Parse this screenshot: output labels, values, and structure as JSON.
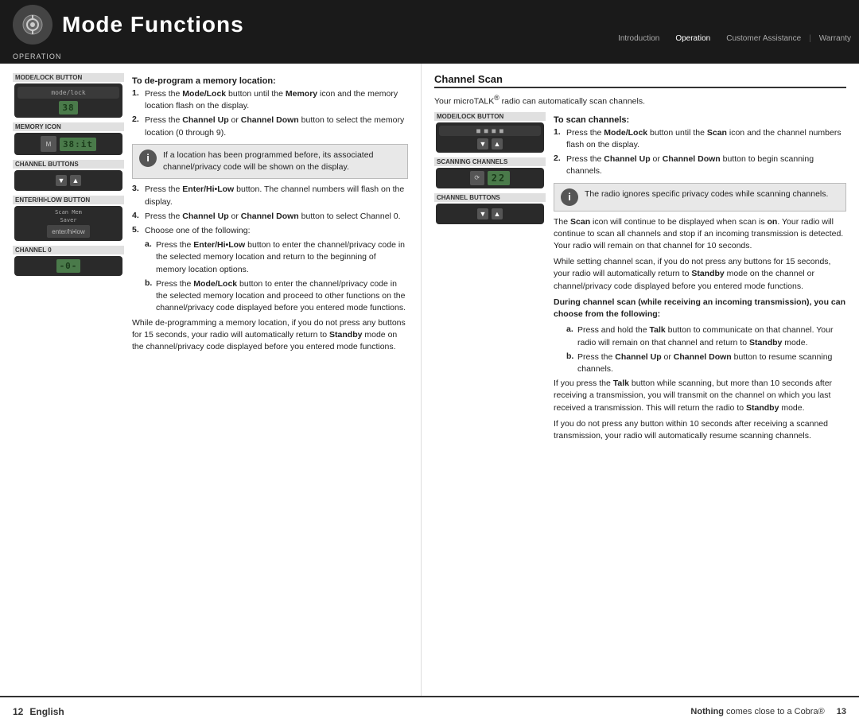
{
  "header": {
    "title": "Mode Functions",
    "icon_alt": "mode-icon",
    "nav_items": [
      "Introduction",
      "Operation",
      "Customer Assistance",
      "Warranty"
    ],
    "operation_label": "Operation"
  },
  "left_section": {
    "subtitle": "To de-program a memory location:",
    "steps": [
      {
        "num": "1.",
        "text_parts": [
          {
            "text": "Press the ",
            "bold": false
          },
          {
            "text": "Mode/Lock",
            "bold": true
          },
          {
            "text": " button until the ",
            "bold": false
          },
          {
            "text": "Memory",
            "bold": true
          },
          {
            "text": " icon and the memory location flash on the display.",
            "bold": false
          }
        ],
        "plain": "Press the Mode/Lock button until the Memory icon and the memory location flash on the display."
      },
      {
        "num": "2.",
        "text_parts": [
          {
            "text": "Press the ",
            "bold": false
          },
          {
            "text": "Channel Up",
            "bold": true
          },
          {
            "text": " or ",
            "bold": false
          },
          {
            "text": "Channel Down",
            "bold": true
          },
          {
            "text": " button to select the memory location (0 through 9).",
            "bold": false
          }
        ],
        "plain": "Press the Channel Up or Channel Down button to select the memory location (0 through 9)."
      },
      {
        "num": "3.",
        "text_parts": [
          {
            "text": "Press the ",
            "bold": false
          },
          {
            "text": "Enter/Hi•Low",
            "bold": true
          },
          {
            "text": " button. The channel numbers will flash on the display.",
            "bold": false
          }
        ],
        "plain": "Press the Enter/Hi•Low button. The channel numbers will flash on the display."
      },
      {
        "num": "4.",
        "text_parts": [
          {
            "text": "Press the ",
            "bold": false
          },
          {
            "text": "Channel Up",
            "bold": true
          },
          {
            "text": " or ",
            "bold": false
          },
          {
            "text": "Channel Down",
            "bold": true
          },
          {
            "text": " button to select Channel 0.",
            "bold": false
          }
        ],
        "plain": "Press the Channel Up or Channel Down button to select Channel 0."
      },
      {
        "num": "5.",
        "plain": "Choose one of the following:"
      }
    ],
    "alpha_a": {
      "label": "a.",
      "text_parts": [
        {
          "text": "Press the ",
          "bold": false
        },
        {
          "text": "Enter/Hi•Low",
          "bold": true
        },
        {
          "text": " button to enter the channel/privacy code in the selected memory location and return to the beginning of memory location options.",
          "bold": false
        }
      ]
    },
    "alpha_b": {
      "label": "b.",
      "text_parts": [
        {
          "text": "Press the ",
          "bold": false
        },
        {
          "text": "Mode/Lock",
          "bold": true
        },
        {
          "text": " button to enter the channel/privacy code in the selected memory location and proceed to other functions on the channel/privacy code displayed before you entered mode functions.",
          "bold": false
        }
      ]
    },
    "info_box": {
      "text": "If a location has been programmed before, its associated channel/privacy code will be shown on the display."
    },
    "closing_text": "While de-programming a memory location, if you do not press any buttons for 15 seconds, your radio will automatically return to Standby mode on the channel/privacy code displayed before you entered mode functions.",
    "image_labels": {
      "mode_lock": "Mode/Lock Button",
      "memory_icon": "Memory Icon",
      "channel_buttons": "Channel Buttons",
      "enter_hi_low": "Enter/Hi•Low Button",
      "channel_0": "Channel 0"
    }
  },
  "right_section": {
    "title": "Channel Scan",
    "intro": "Your microTALK® radio can automatically scan channels.",
    "subtitle": "To scan channels:",
    "steps": [
      {
        "num": "1.",
        "text_parts": [
          {
            "text": "Press the ",
            "bold": false
          },
          {
            "text": "Mode/Lock",
            "bold": true
          },
          {
            "text": " button until the ",
            "bold": false
          },
          {
            "text": "Scan",
            "bold": true
          },
          {
            "text": " icon and the channel numbers flash on the display.",
            "bold": false
          }
        ]
      },
      {
        "num": "2.",
        "text_parts": [
          {
            "text": "Press the ",
            "bold": false
          },
          {
            "text": "Channel Up",
            "bold": true
          },
          {
            "text": " or ",
            "bold": false
          },
          {
            "text": "Channel Down",
            "bold": true
          },
          {
            "text": " button to begin scanning channels.",
            "bold": false
          }
        ]
      }
    ],
    "info_box": {
      "text": "The radio ignores specific privacy codes while scanning channels."
    },
    "scan_description": "The Scan icon will continue to be displayed when scan is on. Your radio will continue to scan all channels and stop if an incoming transmission is detected. Your radio will remain on that channel for 10 seconds.",
    "para2": "While setting channel scan, if you do not press any buttons for 15 seconds, your radio will automatically return to Standby mode on the channel or channel/privacy code displayed before you entered mode functions.",
    "bold_heading": "During channel scan (while receiving an incoming transmission), you can choose from the following:",
    "alpha_a": {
      "label": "a.",
      "text": "Press and hold the Talk button to communicate on that channel. Your radio will remain on that channel and return to Standby mode."
    },
    "alpha_b": {
      "label": "b.",
      "text_parts": [
        {
          "text": "Press the ",
          "bold": false
        },
        {
          "text": "Channel Up",
          "bold": true
        },
        {
          "text": " or ",
          "bold": false
        },
        {
          "text": "Channel Down",
          "bold": true
        },
        {
          "text": " button to resume scanning channels.",
          "bold": false
        }
      ]
    },
    "para3": "If you press the Talk button while scanning, but more than 10 seconds after receiving a transmission, you will transmit on the channel on which you last received a transmission. This will return the radio to Standby mode.",
    "para4": "If you do not press any button within 10 seconds after receiving a scanned transmission, your radio will automatically resume scanning channels.",
    "image_labels": {
      "mode_lock": "Mode/Lock Button",
      "scanning_channels": "Scanning Channels",
      "channel_buttons": "Channel Buttons"
    }
  },
  "footer": {
    "page_left": "12",
    "lang": "English",
    "tagline_bold": "Nothing",
    "tagline_rest": " comes close to a Cobra®",
    "page_right": "13"
  }
}
